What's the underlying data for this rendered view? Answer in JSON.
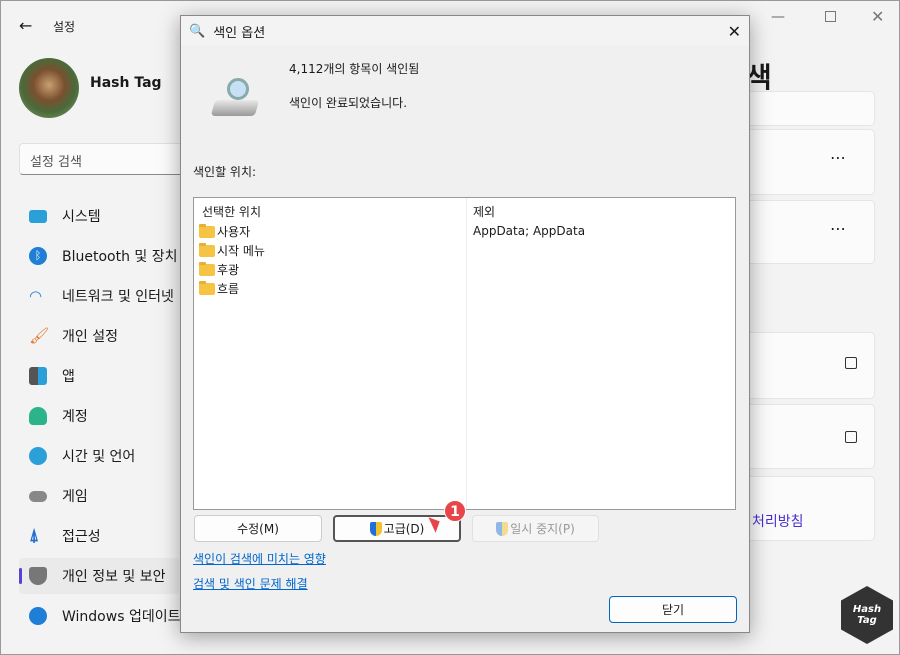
{
  "window": {
    "title": "설정",
    "page_title_partial": "색",
    "controls": [
      "minimize",
      "maximize",
      "close"
    ]
  },
  "user": {
    "name": "Hash Tag"
  },
  "search": {
    "placeholder": "설정 검색"
  },
  "sidebar": {
    "items": [
      {
        "label": "시스템",
        "icon": "system-icon"
      },
      {
        "label": "Bluetooth 및 장치",
        "icon": "bluetooth-icon"
      },
      {
        "label": "네트워크 및 인터넷",
        "icon": "wifi-icon"
      },
      {
        "label": "개인 설정",
        "icon": "brush-icon"
      },
      {
        "label": "앱",
        "icon": "apps-icon"
      },
      {
        "label": "계정",
        "icon": "account-icon"
      },
      {
        "label": "시간 및 언어",
        "icon": "globe-clock-icon"
      },
      {
        "label": "게임",
        "icon": "gamepad-icon"
      },
      {
        "label": "접근성",
        "icon": "accessibility-icon"
      },
      {
        "label": "개인 정보 및 보안",
        "icon": "shield-icon",
        "selected": true
      },
      {
        "label": "Windows 업데이트",
        "icon": "update-icon"
      }
    ]
  },
  "right": {
    "privacy_link_partial": "처리방침",
    "accent": "#4a2fd0"
  },
  "dialog": {
    "title": "색인 옵션",
    "indexed_count": "4,112개의 항목이 색인됨",
    "status": "색인이 완료되었습니다.",
    "locations_label": "색인할 위치:",
    "columns": [
      "선택한 위치",
      "제외"
    ],
    "locations": [
      "사용자",
      "시작 메뉴",
      "후광",
      "흐름"
    ],
    "exclusions": [
      "AppData; AppData"
    ],
    "buttons": {
      "modify": "수정(M)",
      "advanced": "고급(D)",
      "pause": "일시 중지(P)",
      "close": "닫기"
    },
    "links": [
      "색인이 검색에 미치는 영향",
      "검색 및 색인 문제 해결"
    ],
    "annotation": "1"
  },
  "watermark": "Hash Tag"
}
